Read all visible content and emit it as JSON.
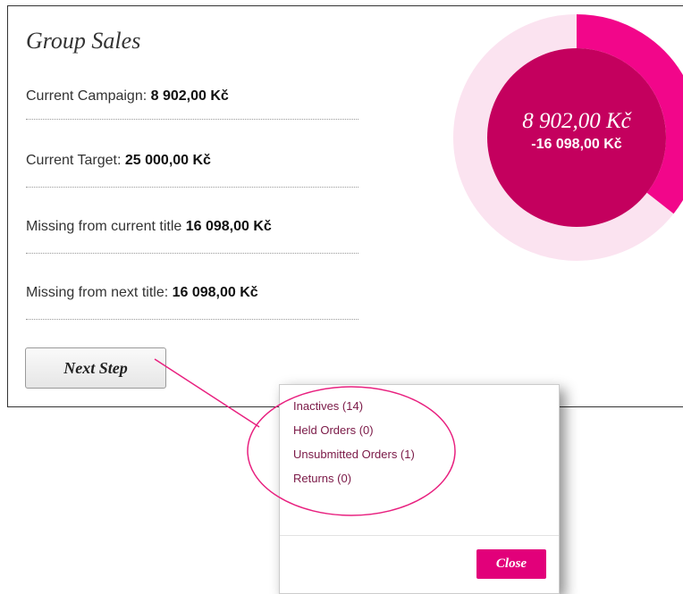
{
  "group_sales": {
    "title": "Group Sales",
    "rows": [
      {
        "label": "Current Campaign: ",
        "value": "8 902,00 Kč"
      },
      {
        "label": "Current Target: ",
        "value": "25 000,00 Kč"
      },
      {
        "label": "Missing from current title ",
        "value": "16 098,00 Kč"
      },
      {
        "label": "Missing from next title: ",
        "value": "16 098,00 Kč"
      }
    ],
    "next_step_label": "Next Step"
  },
  "donut": {
    "amount": "8 902,00 Kč",
    "difference": "-16 098,00 Kč",
    "progress_fraction": 0.356,
    "colors": {
      "track": "#fbe3f0",
      "progress": "#f2068a",
      "center": "#c4005e",
      "text": "#ffffff"
    }
  },
  "popup": {
    "items": [
      {
        "label": "Inactives (14)"
      },
      {
        "label": "Held Orders (0)"
      },
      {
        "label": "Unsubmitted Orders (1)"
      },
      {
        "label": "Returns (0)"
      }
    ],
    "close_label": "Close"
  },
  "theme": {
    "accent": "#e2007a",
    "annotation": "#e8207f"
  }
}
